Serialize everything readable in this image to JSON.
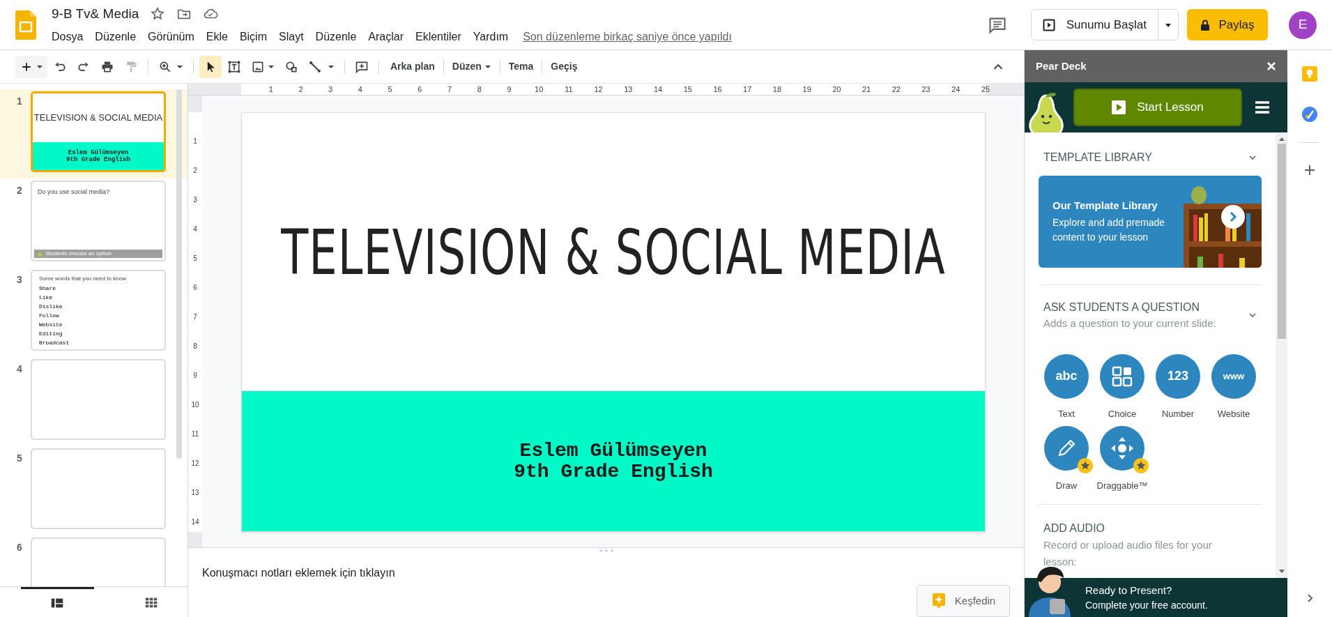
{
  "header": {
    "doc_title": "9-B Tv& Media",
    "menu": [
      "Dosya",
      "Düzenle",
      "Görünüm",
      "Ekle",
      "Biçim",
      "Slayt",
      "Düzenle",
      "Araçlar",
      "Eklentiler",
      "Yardım"
    ],
    "last_edit": "Son düzenleme birkaç saniye önce yapıldı",
    "present_button": "Sunumu Başlat",
    "share_button": "Paylaş",
    "avatar": "E"
  },
  "toolbar": {
    "select_tool_active": true,
    "text_buttons": [
      {
        "label": "Arka plan",
        "dropdown": false
      },
      {
        "label": "Düzen",
        "dropdown": true
      },
      {
        "label": "Tema",
        "dropdown": false
      },
      {
        "label": "Geçiş",
        "dropdown": false
      }
    ]
  },
  "ruler": {
    "horizontal": [
      "1",
      "2",
      "3",
      "4",
      "5",
      "6",
      "7",
      "8",
      "9",
      "10",
      "11",
      "12",
      "13",
      "14",
      "15",
      "16",
      "17",
      "18",
      "19",
      "20",
      "21",
      "22",
      "23",
      "24",
      "25"
    ],
    "vertical": [
      "1",
      "2",
      "3",
      "4",
      "5",
      "6",
      "7",
      "8",
      "9",
      "10",
      "11",
      "12",
      "13",
      "14"
    ]
  },
  "filmstrip": [
    {
      "number": "1",
      "selected": true,
      "kind": "title",
      "title": "TELEVISION & SOCIAL MEDIA",
      "lines": [
        "Eslem Gülümseyen",
        "9th Grade English"
      ]
    },
    {
      "number": "2",
      "selected": false,
      "kind": "question",
      "title": "Do you use social media?",
      "footer": "Students choose an option"
    },
    {
      "number": "3",
      "selected": false,
      "kind": "list",
      "title": "Some words that you need to know",
      "lines": [
        "Share",
        "Like",
        "Dislike",
        "Follow",
        "Website",
        "Editing",
        "Broadcast"
      ]
    },
    {
      "number": "4",
      "selected": false,
      "kind": "blank"
    },
    {
      "number": "5",
      "selected": false,
      "kind": "blank"
    },
    {
      "number": "6",
      "selected": false,
      "kind": "blank"
    }
  ],
  "view_tabs": [
    {
      "selected": true
    },
    {
      "selected": false
    }
  ],
  "slide": {
    "title": "TELEVISION & SOCIAL MEDIA",
    "subtitle": [
      "Eslem Gülümseyen",
      "9th Grade English"
    ]
  },
  "speaker_notes": {
    "placeholder": "Konuşmacı notları eklemek için tıklayın"
  },
  "explore_button": "Keşfedin",
  "pear_deck": {
    "title": "Pear Deck",
    "start_button": "Start Lesson",
    "template_section": {
      "heading": "TEMPLATE LIBRARY",
      "card_title": "Our Template Library",
      "card_text": "Explore and add premade content to your lesson"
    },
    "question_section": {
      "heading": "ASK STUDENTS A QUESTION",
      "subtitle": "Adds a question to your current slide:"
    },
    "question_types": [
      {
        "label": "Text",
        "kind": "glyph",
        "glyph": "abc",
        "premium": false
      },
      {
        "label": "Choice",
        "kind": "choice",
        "premium": false
      },
      {
        "label": "Number",
        "kind": "glyph",
        "glyph": "123",
        "premium": false
      },
      {
        "label": "Website",
        "kind": "glyph",
        "glyph": "www",
        "premium": false
      },
      {
        "label": "Draw",
        "kind": "draw",
        "premium": true
      },
      {
        "label": "Draggable™",
        "kind": "drag",
        "premium": true
      }
    ],
    "audio_section": {
      "heading": "ADD AUDIO",
      "text": "Record or upload audio files for your lesson:"
    },
    "banner": {
      "title": "Ready to Present?",
      "text": "Complete your free account."
    }
  }
}
